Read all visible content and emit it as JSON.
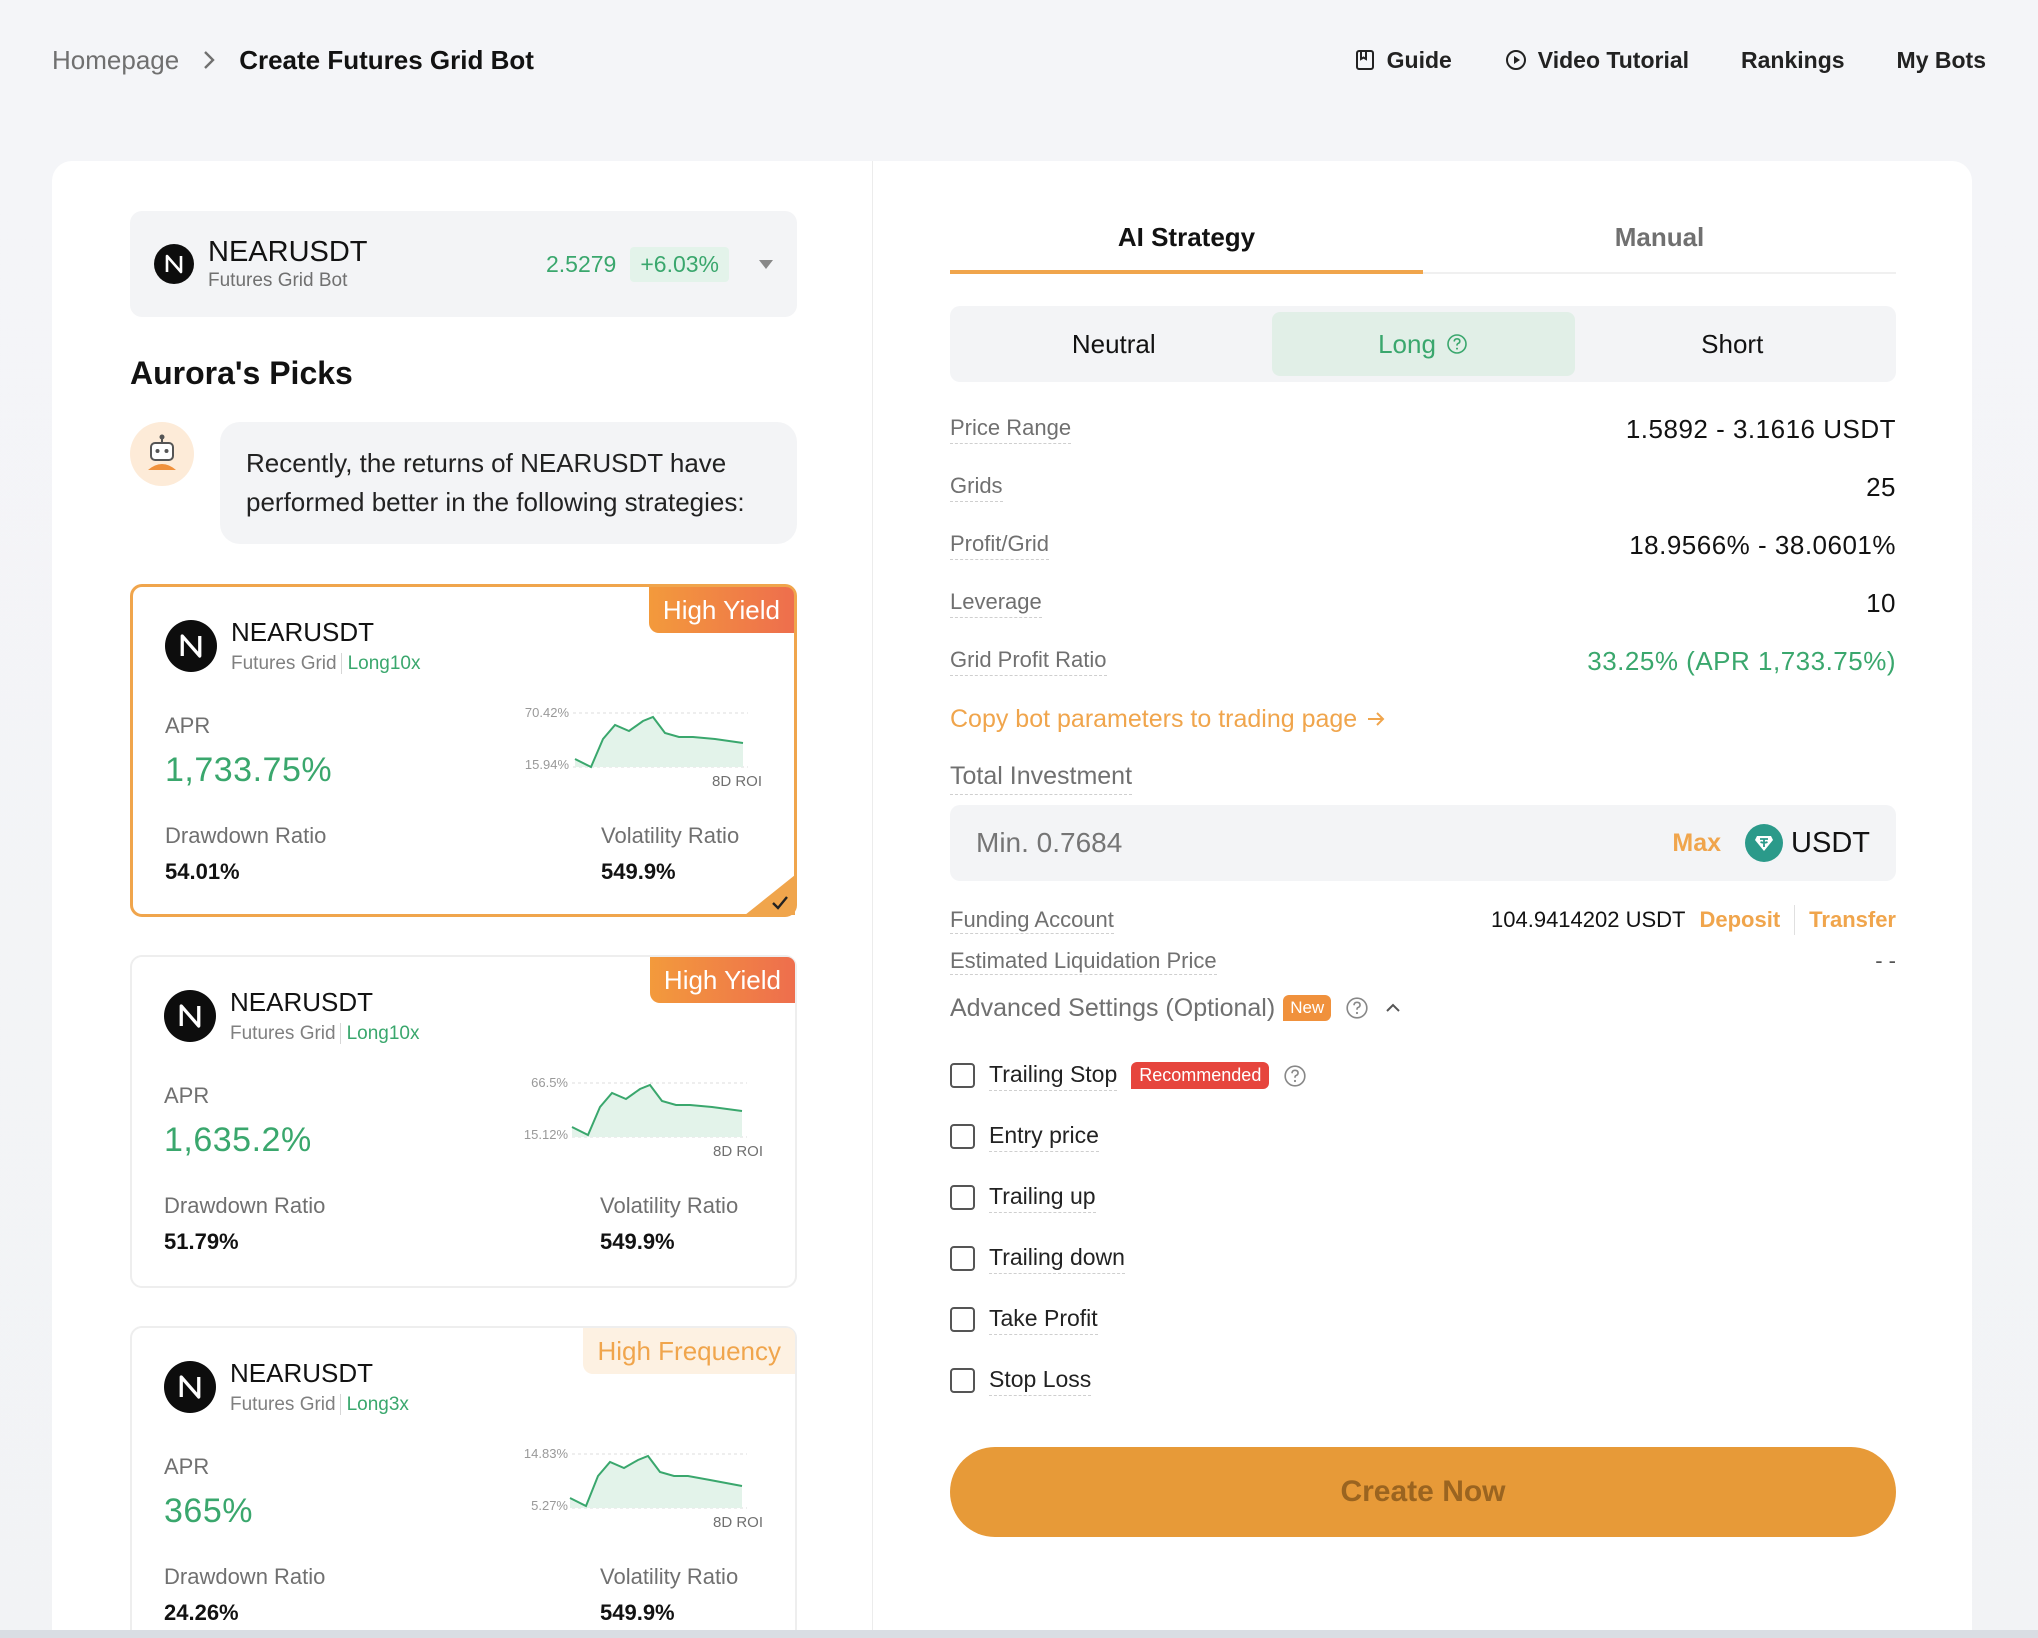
{
  "breadcrumb": {
    "home": "Homepage",
    "current": "Create Futures Grid Bot"
  },
  "nav": {
    "guide": "Guide",
    "video": "Video Tutorial",
    "rankings": "Rankings",
    "mybots": "My Bots"
  },
  "pair": {
    "name": "NEARUSDT",
    "sub": "Futures Grid Bot",
    "price": "2.5279",
    "change": "+6.03%"
  },
  "picks": {
    "title": "Aurora's Picks",
    "message": "Recently, the returns of NEARUSDT have performed better in the following strategies:",
    "cards": [
      {
        "tag": "High Yield",
        "name": "NEARUSDT",
        "type": "Futures Grid",
        "lev": "Long10x",
        "apr_label": "APR",
        "apr": "1,733.75%",
        "dd_label": "Drawdown Ratio",
        "dd": "54.01%",
        "vol_label": "Volatility Ratio",
        "vol": "549.9%",
        "hi": "70.42%",
        "lo": "15.94%",
        "roi": "8D ROI"
      },
      {
        "tag": "High Yield",
        "name": "NEARUSDT",
        "type": "Futures Grid",
        "lev": "Long10x",
        "apr_label": "APR",
        "apr": "1,635.2%",
        "dd_label": "Drawdown Ratio",
        "dd": "51.79%",
        "vol_label": "Volatility Ratio",
        "vol": "549.9%",
        "hi": "66.5%",
        "lo": "15.12%",
        "roi": "8D ROI"
      },
      {
        "tag": "High Frequency",
        "name": "NEARUSDT",
        "type": "Futures Grid",
        "lev": "Long3x",
        "apr_label": "APR",
        "apr": "365%",
        "dd_label": "Drawdown Ratio",
        "dd": "24.26%",
        "vol_label": "Volatility Ratio",
        "vol": "549.9%",
        "hi": "14.83%",
        "lo": "5.27%",
        "roi": "8D ROI"
      }
    ]
  },
  "tabs": {
    "ai": "AI Strategy",
    "manual": "Manual"
  },
  "modes": {
    "neutral": "Neutral",
    "long": "Long",
    "short": "Short"
  },
  "params": {
    "price_range_k": "Price Range",
    "price_range_v": "1.5892 - 3.1616 USDT",
    "grids_k": "Grids",
    "grids_v": "25",
    "profit_k": "Profit/Grid",
    "profit_v": "18.9566% - 38.0601%",
    "leverage_k": "Leverage",
    "leverage_v": "10",
    "gpr_k": "Grid Profit Ratio",
    "gpr_v": "33.25% (APR 1,733.75%)"
  },
  "copy_link": "Copy bot parameters to trading page",
  "investment": {
    "title": "Total Investment",
    "placeholder": "Min. 0.7684",
    "max": "Max",
    "currency": "USDT",
    "funding_label": "Funding Account",
    "funding_value": "104.9414202 USDT",
    "deposit": "Deposit",
    "transfer": "Transfer",
    "liq_label": "Estimated Liquidation Price",
    "liq_value": "- -"
  },
  "advanced": {
    "label": "Advanced Settings (Optional)",
    "new": "New",
    "recommended": "Recommended",
    "options": [
      "Trailing Stop",
      "Entry price",
      "Trailing up",
      "Trailing down",
      "Take Profit",
      "Stop Loss"
    ]
  },
  "create": "Create Now",
  "colors": {
    "accent": "#f0a54c",
    "green": "#3aa76d",
    "button": "#e79a38"
  }
}
